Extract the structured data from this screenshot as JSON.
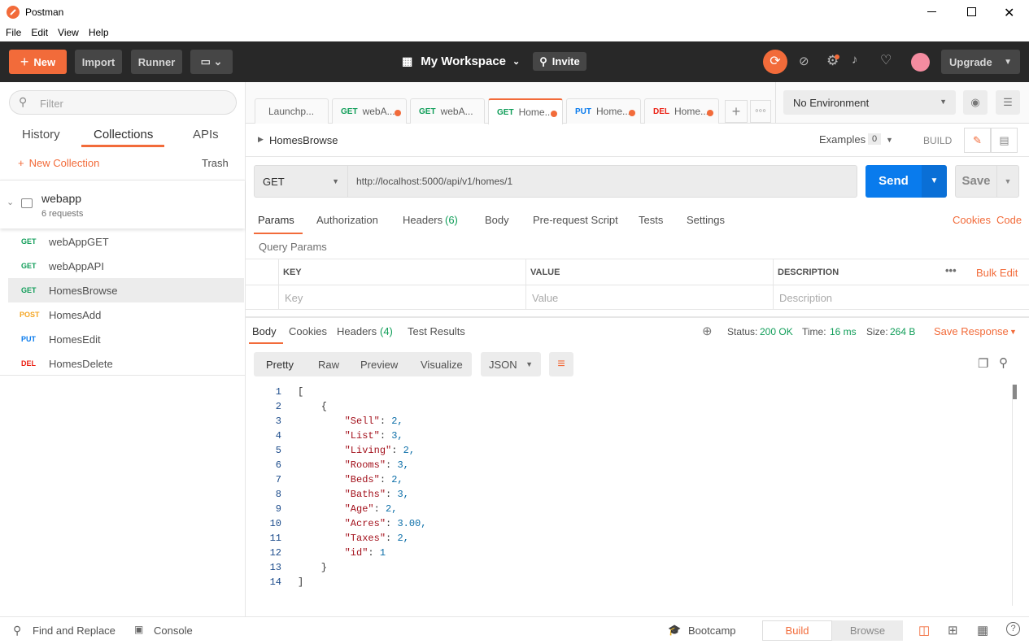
{
  "window": {
    "title": "Postman"
  },
  "menu": [
    "File",
    "Edit",
    "View",
    "Help"
  ],
  "header": {
    "new_label": "New",
    "import_label": "Import",
    "runner_label": "Runner",
    "workspace_label": "My Workspace",
    "invite_label": "Invite",
    "upgrade_label": "Upgrade"
  },
  "sidebar": {
    "filter_placeholder": "Filter",
    "tabs": [
      "History",
      "Collections",
      "APIs"
    ],
    "active_tab": "Collections",
    "new_collection_label": "New Collection",
    "trash_label": "Trash",
    "collection": {
      "name": "webapp",
      "count": "6 requests"
    },
    "requests": [
      {
        "method": "GET",
        "name": "webAppGET",
        "color": "#0f9d58"
      },
      {
        "method": "GET",
        "name": "webAppAPI",
        "color": "#0f9d58"
      },
      {
        "method": "GET",
        "name": "HomesBrowse",
        "color": "#0f9d58"
      },
      {
        "method": "POST",
        "name": "HomesAdd",
        "color": "#f5a623"
      },
      {
        "method": "PUT",
        "name": "HomesEdit",
        "color": "#097bed"
      },
      {
        "method": "DEL",
        "name": "HomesDelete",
        "color": "#eb2013"
      }
    ]
  },
  "tabs": [
    {
      "method": "",
      "label": "Launchp..."
    },
    {
      "method": "GET",
      "label": "webA..."
    },
    {
      "method": "GET",
      "label": "webA..."
    },
    {
      "method": "GET",
      "label": "Home..."
    },
    {
      "method": "PUT",
      "label": "Home..."
    },
    {
      "method": "DEL",
      "label": "Home..."
    }
  ],
  "environment": "No Environment",
  "request": {
    "name": "HomesBrowse",
    "examples_label": "Examples",
    "examples_count": "0",
    "build_label": "BUILD",
    "method": "GET",
    "url": "http://localhost:5000/api/v1/homes/1",
    "send_label": "Send",
    "save_label": "Save",
    "tabs": [
      "Params",
      "Authorization",
      "Headers",
      "Body",
      "Pre-request Script",
      "Tests",
      "Settings"
    ],
    "headers_count": "(6)",
    "cookies_label": "Cookies",
    "code_label": "Code",
    "query_params_label": "Query Params",
    "columns": [
      "KEY",
      "VALUE",
      "DESCRIPTION"
    ],
    "bulk_edit_label": "Bulk Edit",
    "placeholders": [
      "Key",
      "Value",
      "Description"
    ]
  },
  "response": {
    "tabs": [
      "Body",
      "Cookies",
      "Headers",
      "Test Results"
    ],
    "headers_count": "(4)",
    "status_label": "Status:",
    "status_value": "200 OK",
    "time_label": "Time:",
    "time_value": "16 ms",
    "size_label": "Size:",
    "size_value": "264 B",
    "save_response_label": "Save Response",
    "view_modes": [
      "Pretty",
      "Raw",
      "Preview",
      "Visualize"
    ],
    "format": "JSON",
    "code_lines": [
      {
        "n": "1",
        "t": "["
      },
      {
        "n": "2",
        "t": "    {"
      },
      {
        "n": "3",
        "k": "\"Sell\"",
        "v": "2,"
      },
      {
        "n": "4",
        "k": "\"List\"",
        "v": "3,"
      },
      {
        "n": "5",
        "k": "\"Living\"",
        "v": "2,"
      },
      {
        "n": "6",
        "k": "\"Rooms\"",
        "v": "3,"
      },
      {
        "n": "7",
        "k": "\"Beds\"",
        "v": "2,"
      },
      {
        "n": "8",
        "k": "\"Baths\"",
        "v": "3,"
      },
      {
        "n": "9",
        "k": "\"Age\"",
        "v": "2,"
      },
      {
        "n": "10",
        "k": "\"Acres\"",
        "v": "3.00,"
      },
      {
        "n": "11",
        "k": "\"Taxes\"",
        "v": "2,"
      },
      {
        "n": "12",
        "k": "\"id\"",
        "v": "1"
      },
      {
        "n": "13",
        "t": "    }"
      },
      {
        "n": "14",
        "t": "]"
      }
    ]
  },
  "footer": {
    "find_replace_label": "Find and Replace",
    "console_label": "Console",
    "bootcamp_label": "Bootcamp",
    "build_label": "Build",
    "browse_label": "Browse"
  },
  "colors": {
    "accent": "#f26b3a",
    "send": "#097bed",
    "header_bg": "#282828",
    "success": "#0f9d58"
  }
}
